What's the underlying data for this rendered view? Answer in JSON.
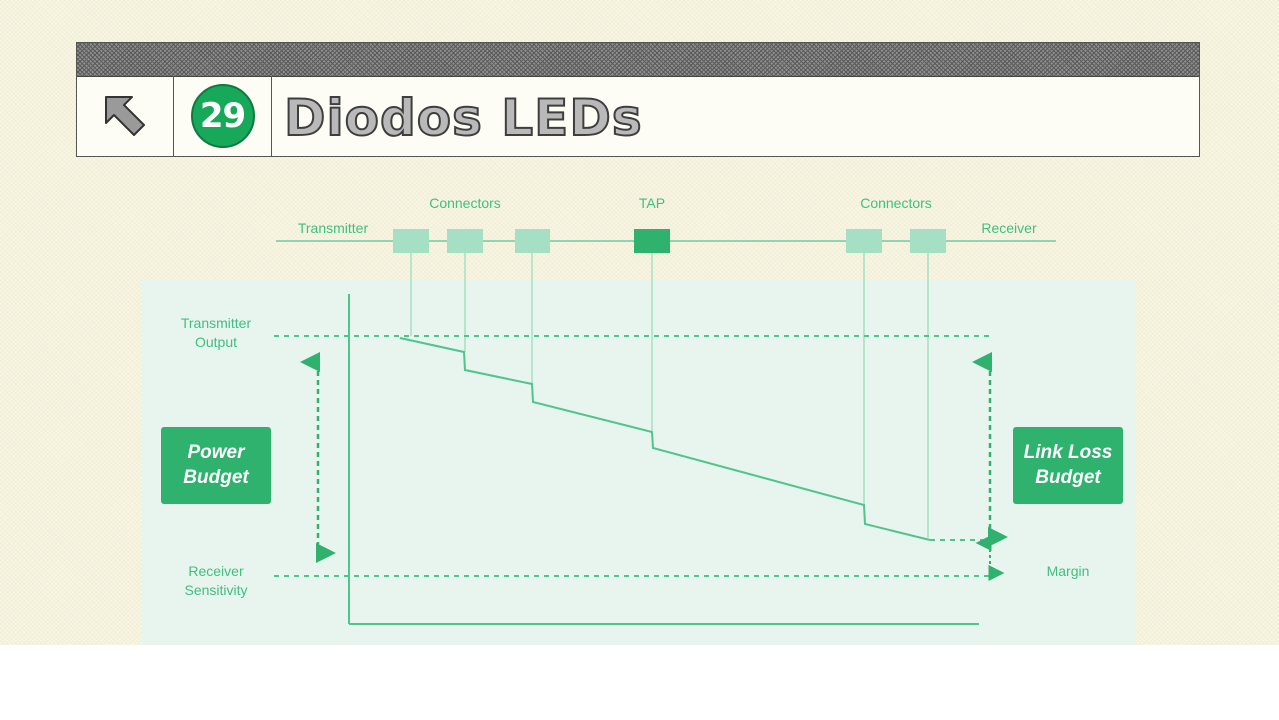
{
  "header": {
    "back_icon": "arrow-up-left-icon",
    "slide_number": "29",
    "title": "Diodos LEDs"
  },
  "diagram": {
    "top_labels": {
      "transmitter": "Transmitter",
      "connectors_left": "Connectors",
      "tap": "TAP",
      "connectors_right": "Connectors",
      "receiver": "Receiver"
    },
    "left_labels": {
      "transmitter_output_line1": "Transmitter",
      "transmitter_output_line2": "Output",
      "receiver_sensitivity_line1": "Receiver",
      "receiver_sensitivity_line2": "Sensitivity"
    },
    "power_budget": {
      "line1": "Power",
      "line2": "Budget"
    },
    "link_loss_budget": {
      "line1": "Link Loss",
      "line2": "Budget"
    },
    "margin_label": "Margin",
    "colors": {
      "light_green": "#a6e0c4",
      "dark_green": "#2fb26e",
      "line_green": "#4fc58c",
      "panel": "#e8f4ee"
    }
  }
}
